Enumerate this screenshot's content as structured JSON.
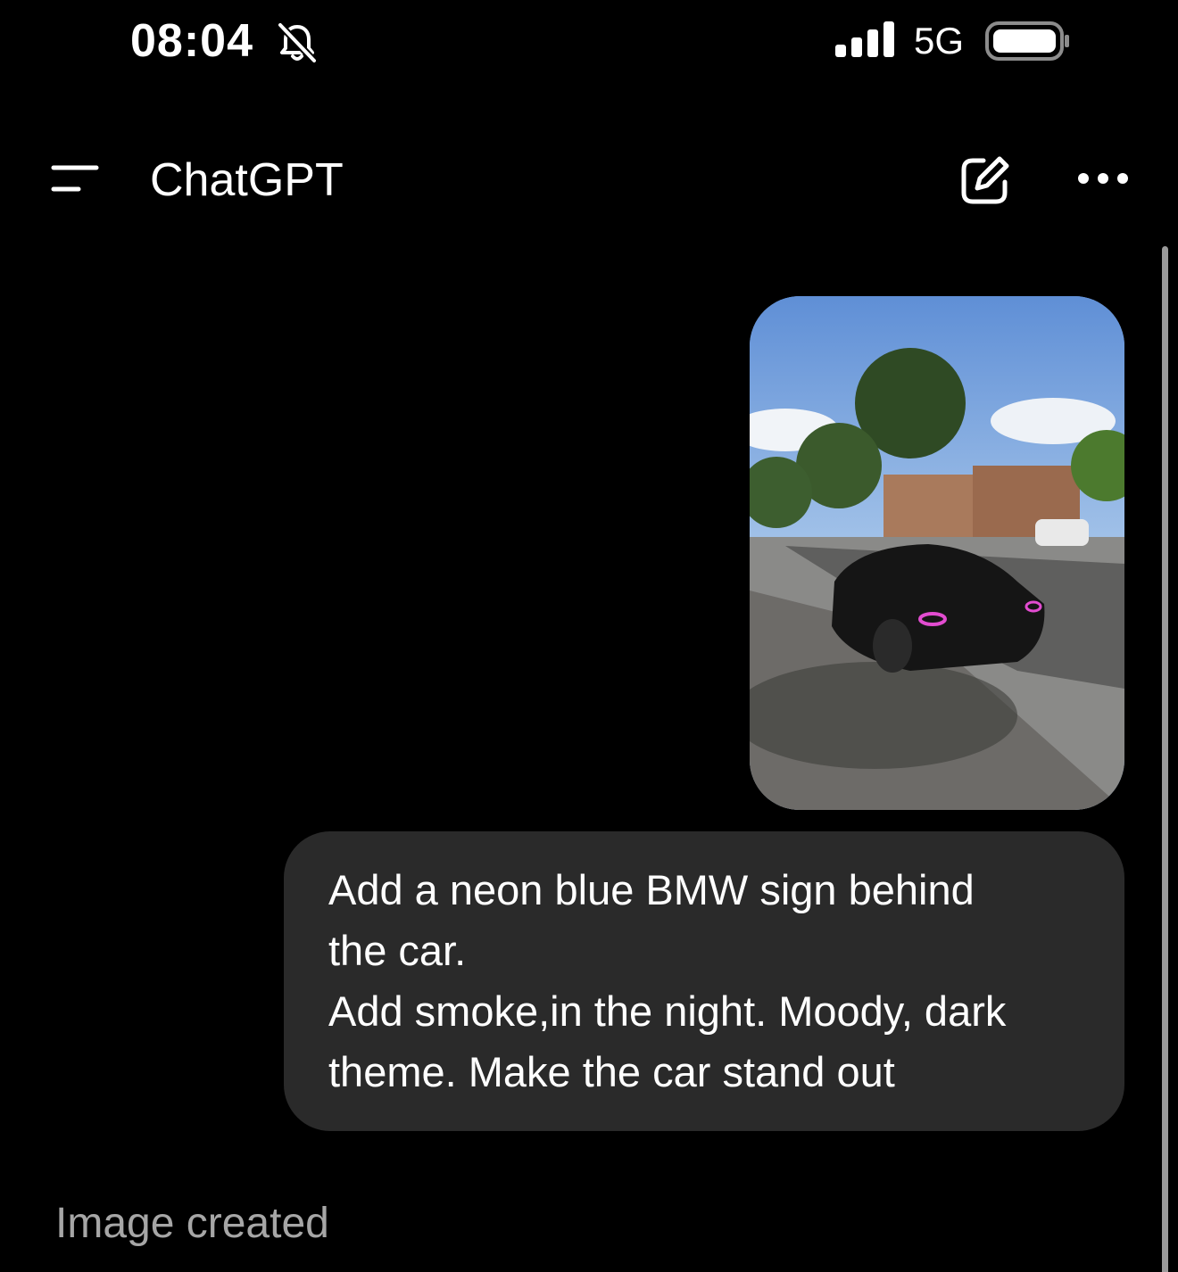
{
  "status_bar": {
    "time": "08:04",
    "network": "5G",
    "icons": [
      "bell-slash-icon",
      "signal-bars-icon",
      "battery-icon"
    ]
  },
  "header": {
    "title": "ChatGPT",
    "icons": [
      "menu-icon",
      "new-chat-icon",
      "more-icon"
    ]
  },
  "conversation": {
    "user_attachment": {
      "type": "photo",
      "icon": "photo-attachment"
    },
    "user_message_lines": [
      "Add a neon blue BMW sign behind",
      "the car.",
      "Add smoke,in the night. Moody, dark",
      "theme. Make the car stand out"
    ],
    "assistant_status": "Image created"
  },
  "colors": {
    "background": "#000000",
    "bubble": "#2a2a2a",
    "text": "#ffffff",
    "muted_text": "#a6a6a6",
    "scrollbar": "#9a9a9a"
  }
}
